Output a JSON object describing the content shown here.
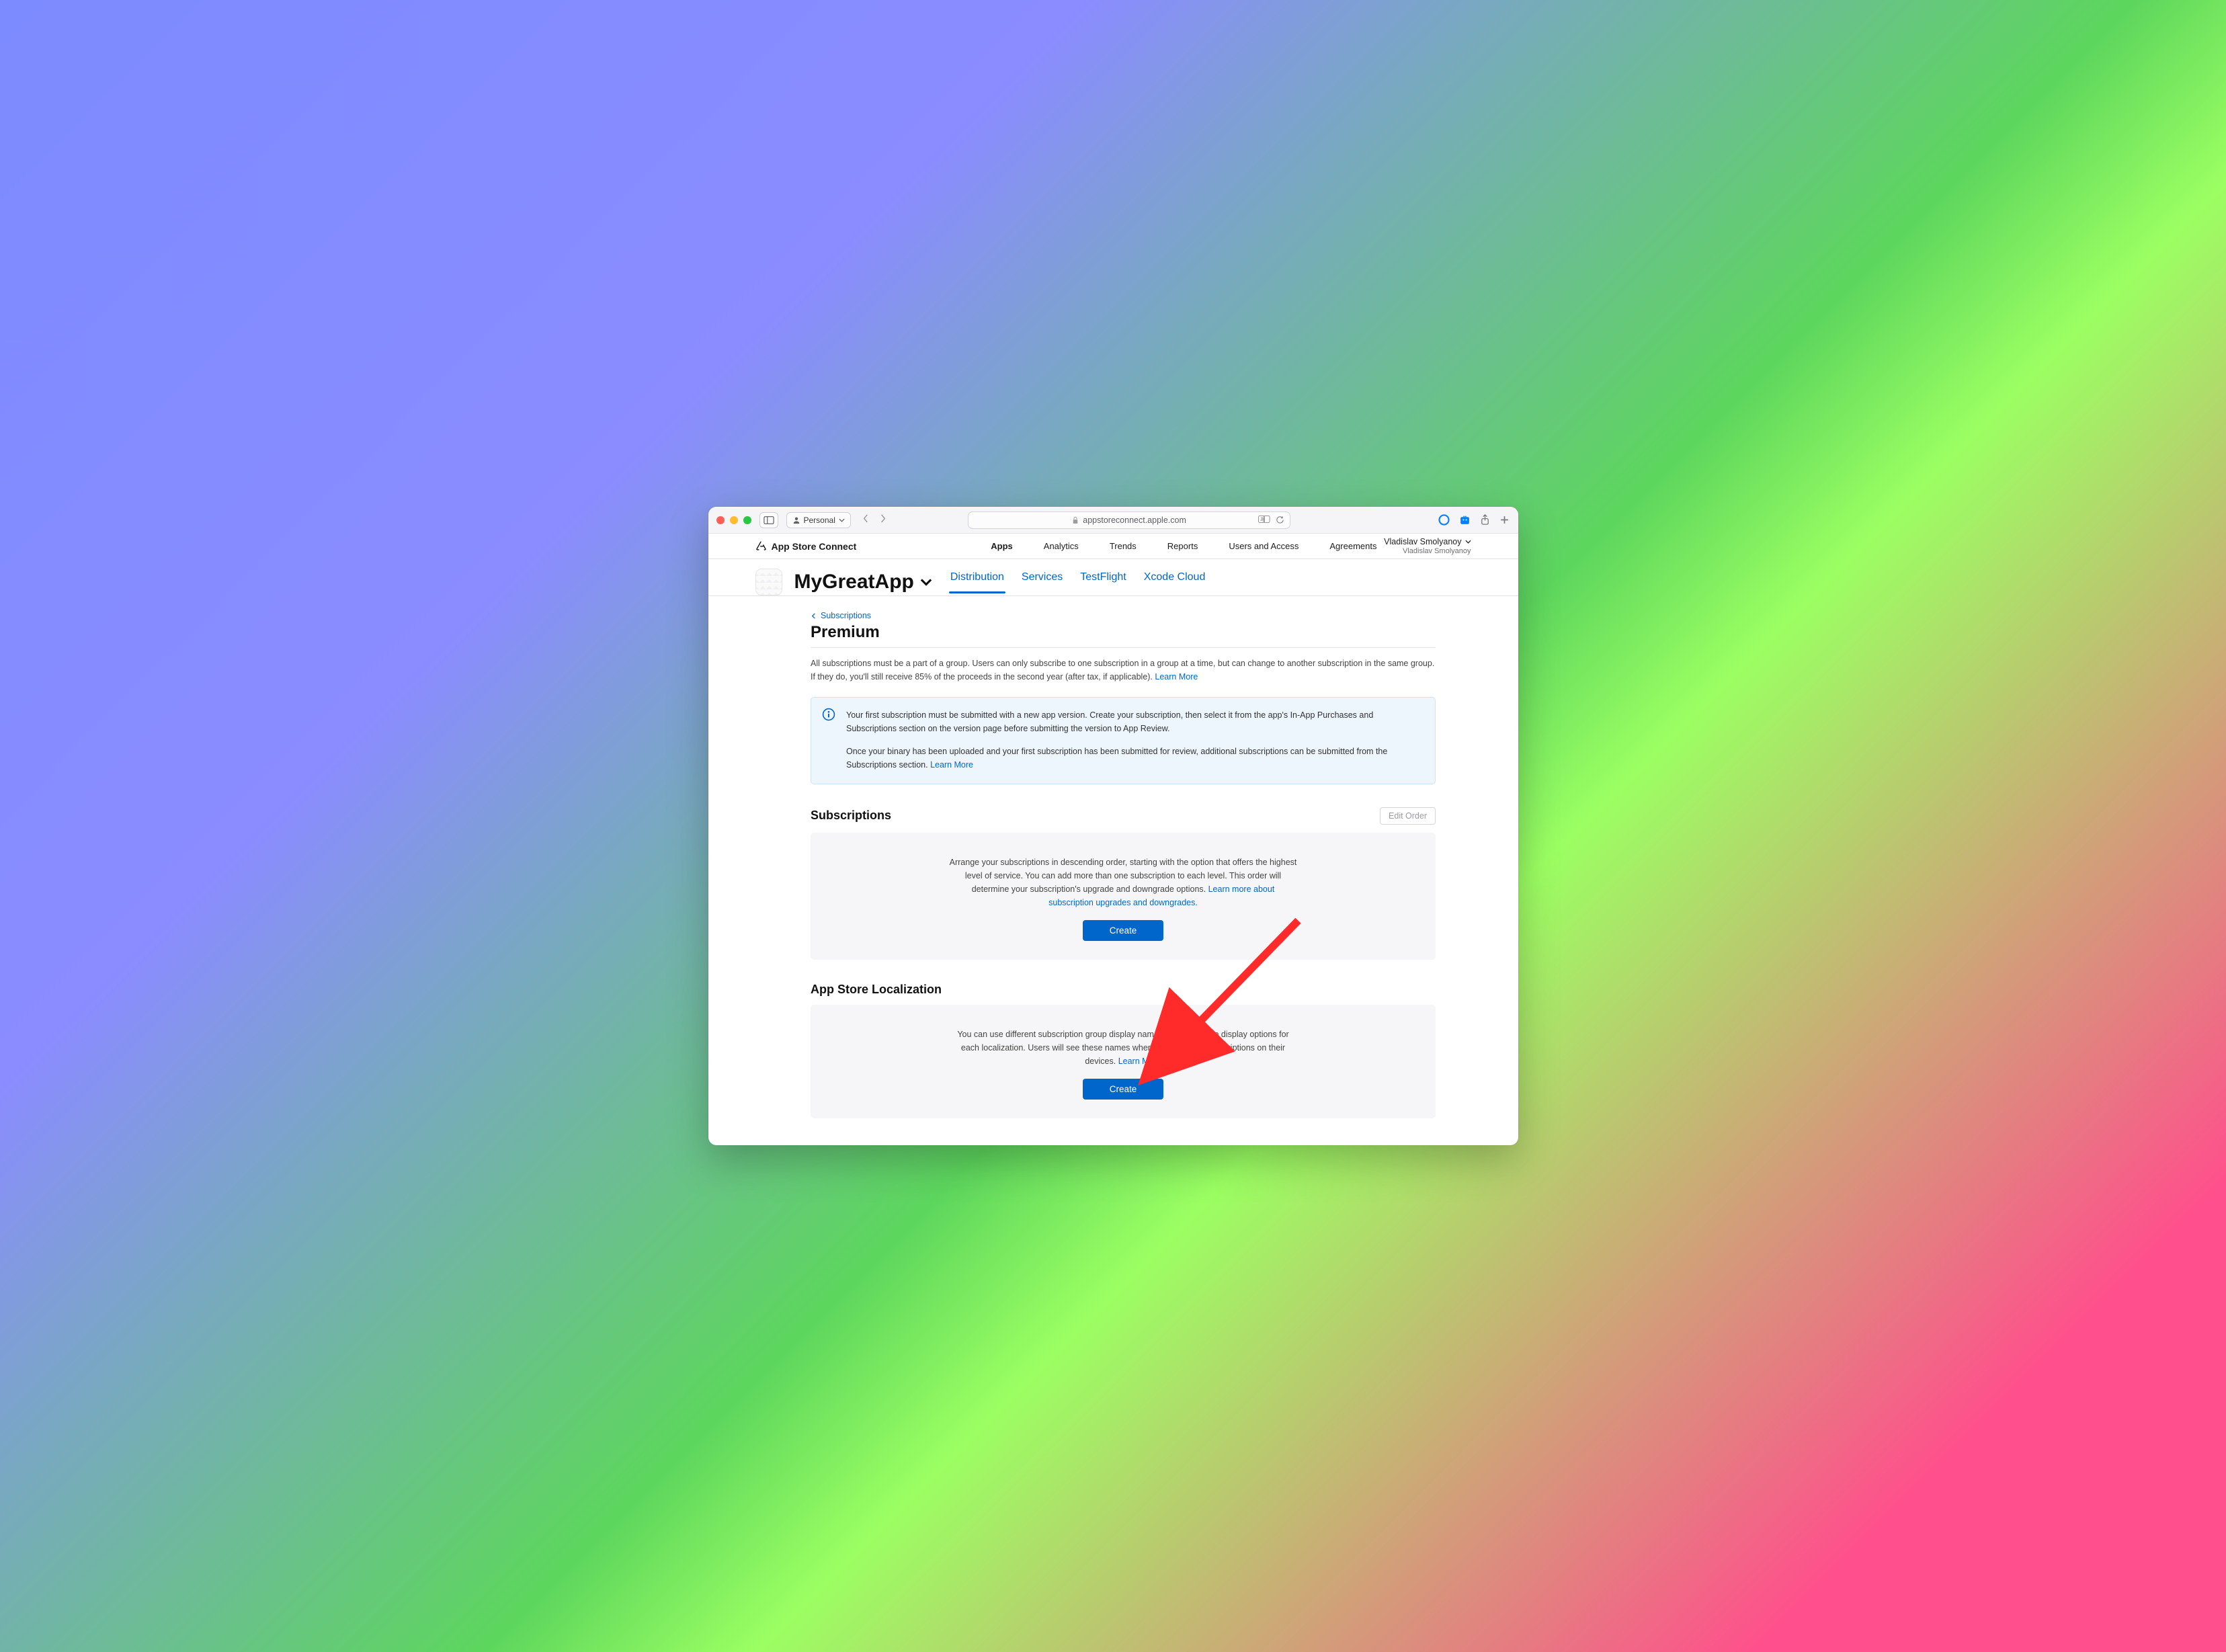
{
  "toolbar": {
    "profile_label": "Personal",
    "url": "appstoreconnect.apple.com"
  },
  "asc_header": {
    "brand": "App Store Connect",
    "nav": [
      "Apps",
      "Analytics",
      "Trends",
      "Reports",
      "Users and Access",
      "Agreements"
    ],
    "active_nav_index": 0,
    "user_main": "Vladislav Smolyanoy",
    "user_sub": "Vladislav Smolyanoy"
  },
  "app_bar": {
    "app_name": "MyGreatApp",
    "tabs": [
      "Distribution",
      "Services",
      "TestFlight",
      "Xcode Cloud"
    ],
    "active_tab_index": 0
  },
  "breadcrumb": {
    "label": "Subscriptions"
  },
  "page": {
    "title": "Premium",
    "intro": "All subscriptions must be a part of a group. Users can only subscribe to one subscription in a group at a time, but can change to another subscription in the same group. If they do, you'll still receive 85% of the proceeds in the second year (after tax, if applicable). ",
    "intro_link": "Learn More"
  },
  "info_box": {
    "p1": "Your first subscription must be submitted with a new app version. Create your subscription, then select it from the app's In-App Purchases and Subscriptions section on the version page before submitting the version to App Review.",
    "p2_pre": "Once your binary has been uploaded and your first subscription has been submitted for review, additional subscriptions can be submitted from the Subscriptions section. ",
    "p2_link": "Learn More"
  },
  "subs_section": {
    "heading": "Subscriptions",
    "edit_btn": "Edit Order",
    "body": "Arrange your subscriptions in descending order, starting with the option that offers the highest level of service. You can add more than one subscription to each level. This order will determine your subscription's upgrade and downgrade options. ",
    "body_link": "Learn more about subscription upgrades and downgrades.",
    "create_btn": "Create"
  },
  "loc_section": {
    "heading": "App Store Localization",
    "body": "You can use different subscription group display names and app name display options for each localization. Users will see these names when they manage subscriptions on their devices. ",
    "body_link": "Learn More",
    "create_btn": "Create"
  }
}
